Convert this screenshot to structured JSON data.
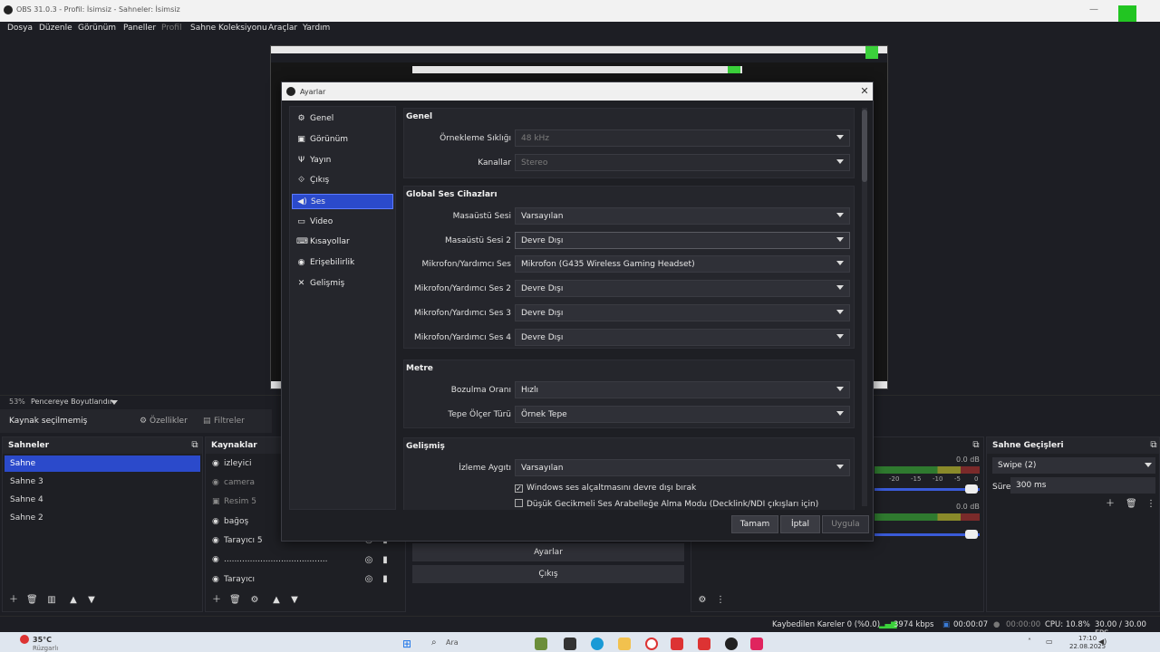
{
  "window": {
    "title": "OBS 31.0.3 - Profil: İsimsiz - Sahneler: İsimsiz"
  },
  "menu": [
    "Dosya",
    "Düzenle",
    "Görünüm",
    "Paneller",
    "Profil",
    "Sahne Koleksiyonu",
    "Araçlar",
    "Yardım"
  ],
  "preview_status": {
    "zoom": "53%",
    "mode": "Pencereye Boyutlandır"
  },
  "source_toolbar": {
    "no_source": "Kaynak seçilmemiş",
    "properties": "Özellikler",
    "filters": "Filtreler"
  },
  "scenes": {
    "title": "Sahneler",
    "items": [
      "Sahne",
      "Sahne 3",
      "Sahne 4",
      "Sahne 2"
    ]
  },
  "sources": {
    "title": "Kaynaklar",
    "items": [
      "izleyici",
      "camera",
      "Resim 5",
      "bağoş",
      "Tarayıcı 5",
      "........................................",
      "Tarayıcı"
    ]
  },
  "transitions": {
    "title": "Sahne Geçişleri",
    "selected": "Swipe (2)",
    "duration_label": "Süre",
    "duration": "300 ms"
  },
  "mixer": {
    "db1": "0.0 dB",
    "db2": "0.0 dB",
    "ticks": [
      "-20",
      "-15",
      "-10",
      "-5",
      "0"
    ]
  },
  "controls": {
    "settings": "Ayarlar",
    "exit": "Çıkış"
  },
  "dialog": {
    "title": "Ayarlar",
    "nav": [
      "Genel",
      "Görünüm",
      "Yayın",
      "Çıkış",
      "Ses",
      "Video",
      "Kısayollar",
      "Erişebilirlik",
      "Gelişmiş"
    ],
    "sections": {
      "genel": {
        "title": "Genel",
        "sample_rate_label": "Örnekleme Sıklığı",
        "sample_rate": "48 kHz",
        "channels_label": "Kanallar",
        "channels": "Stereo"
      },
      "global": {
        "title": "Global Ses Cihazları",
        "rows": [
          {
            "label": "Masaüstü Sesi",
            "value": "Varsayılan"
          },
          {
            "label": "Masaüstü Sesi 2",
            "value": "Devre Dışı"
          },
          {
            "label": "Mikrofon/Yardımcı Ses",
            "value": "Mikrofon (G435 Wireless Gaming Headset)"
          },
          {
            "label": "Mikrofon/Yardımcı Ses 2",
            "value": "Devre Dışı"
          },
          {
            "label": "Mikrofon/Yardımcı Ses 3",
            "value": "Devre Dışı"
          },
          {
            "label": "Mikrofon/Yardımcı Ses 4",
            "value": "Devre Dışı"
          }
        ]
      },
      "metre": {
        "title": "Metre",
        "decay_label": "Bozulma Oranı",
        "decay": "Hızlı",
        "peak_label": "Tepe Ölçer Türü",
        "peak": "Örnek Tepe"
      },
      "advanced": {
        "title": "Gelişmiş",
        "monitor_label": "İzleme Aygıtı",
        "monitor": "Varsayılan",
        "check1": "Windows ses alçaltmasını devre dışı bırak",
        "check2": "Düşük Gecikmeli Ses Arabelleğe Alma Modu (Decklink/NDI çıkışları için)"
      }
    },
    "buttons": {
      "ok": "Tamam",
      "cancel": "İptal",
      "apply": "Uygula"
    }
  },
  "status": {
    "dropped": "Kaybedilen Kareler 0 (%0.0)",
    "bitrate": "3974 kbps",
    "stream_time": "00:00:07",
    "rec_time": "00:00:00",
    "cpu": "CPU: 10.8%",
    "fps": "30.00 / 30.00 FPS"
  },
  "taskbar": {
    "weather_temp": "35°C",
    "weather_desc": "Rüzgarlı",
    "search": "Ara",
    "time": "17:10",
    "date": "22.08.2025"
  }
}
